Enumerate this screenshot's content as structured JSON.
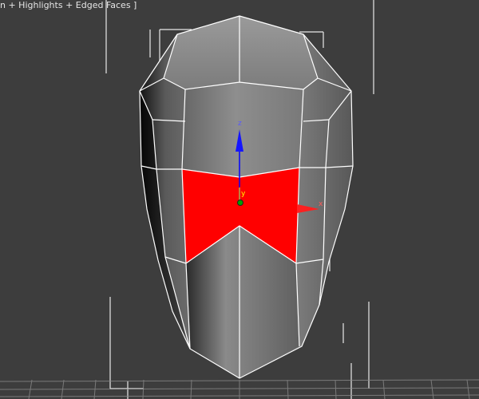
{
  "viewport": {
    "label": "n + Highlights + Edged Faces ]",
    "background": "#3d3d3d"
  },
  "gizmo": {
    "x_label": "x",
    "y_label": "y",
    "z_label": "z",
    "x_color": "#ff0000",
    "y_color": "#ffff00",
    "z_color": "#0000ff"
  },
  "selection": {
    "color": "#ff0000"
  },
  "mesh": {
    "wire_color": "#ffffff"
  },
  "icons": {
    "transform_gizmo": "move-gizmo-icon",
    "pivot": "pivot-dot-icon"
  }
}
